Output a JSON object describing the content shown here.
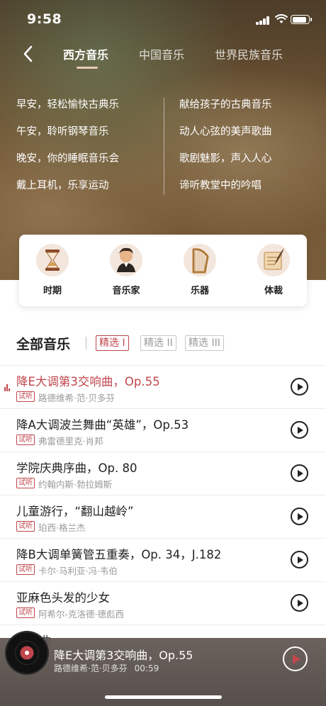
{
  "status": {
    "time": "9:58"
  },
  "nav": {
    "tabs": [
      {
        "label": "西方音乐",
        "active": true
      },
      {
        "label": "中国音乐",
        "active": false
      },
      {
        "label": "世界民族音乐",
        "active": false
      }
    ]
  },
  "playlists": {
    "left": [
      "早安，轻松愉快古典乐",
      "午安，聆听钢琴音乐",
      "晚安，你的睡眠音乐会",
      "戴上耳机，乐享运动"
    ],
    "right": [
      "献给孩子的古典音乐",
      "动人心弦的美声歌曲",
      "歌剧魅影，声入人心",
      "谛听教堂中的吟唱"
    ]
  },
  "categories": [
    {
      "label": "时期",
      "icon": "hourglass-icon"
    },
    {
      "label": "音乐家",
      "icon": "composer-bust-icon"
    },
    {
      "label": "乐器",
      "icon": "harp-icon"
    },
    {
      "label": "体裁",
      "icon": "scroll-quill-icon"
    }
  ],
  "section": {
    "title": "全部音乐",
    "filters": [
      {
        "label": "精选 I",
        "active": true
      },
      {
        "label": "精选 II",
        "active": false
      },
      {
        "label": "精选 III",
        "active": false
      }
    ]
  },
  "tracks": [
    {
      "title": "降E大调第3交响曲，Op.55",
      "badge": "试听",
      "artist": "路德维希·范·贝多芬",
      "playing": true
    },
    {
      "title": "降A大调波兰舞曲“英雄”，Op.53",
      "badge": "试听",
      "artist": "弗雷德里克·肖邦",
      "playing": false
    },
    {
      "title": "学院庆典序曲，Op. 80",
      "badge": "试听",
      "artist": "约翰内斯·勃拉姆斯",
      "playing": false
    },
    {
      "title": "儿童游行，“翻山越岭”",
      "badge": "试听",
      "artist": "珀西·格兰杰",
      "playing": false
    },
    {
      "title": "降B大调单簧管五重奏，Op. 34，J.182",
      "badge": "试听",
      "artist": "卡尔·马利亚·冯·韦伯",
      "playing": false
    },
    {
      "title": "亚麻色头发的少女",
      "badge": "试听",
      "artist": "阿希尔-克洛德·德彪西",
      "playing": false
    }
  ],
  "partial_track": {
    "title": "…奏曲"
  },
  "player": {
    "title": "降E大调第3交响曲，Op.55",
    "artist": "路德维希·范·贝多芬",
    "duration": "00:59"
  },
  "colors": {
    "accent": "#c0464c",
    "hero": "#6f5535"
  }
}
